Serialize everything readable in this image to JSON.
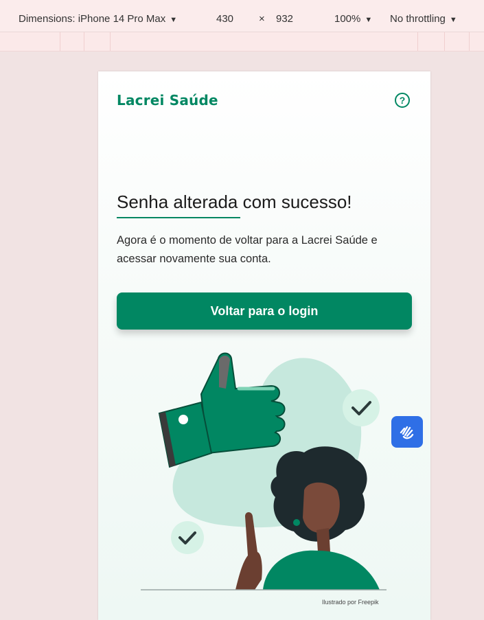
{
  "devtools": {
    "dimensions_label": "Dimensions: iPhone 14 Pro Max",
    "width": "430",
    "times": "×",
    "height": "932",
    "zoom": "100%",
    "throttling": "No throttling",
    "dropdown_glyph": "▼"
  },
  "header": {
    "brand": "Lacrei Saúde",
    "help_glyph": "?"
  },
  "main": {
    "title": "Senha alterada com sucesso!",
    "description": "Agora é o momento de voltar para a Lacrei Saúde e acessar novamente sua conta.",
    "button_label": "Voltar para o login",
    "credit": "Ilustrado por Freepik"
  },
  "icons": {
    "help": "question-circle-icon",
    "accessibility": "sign-language-icon",
    "check": "check-icon"
  },
  "colors": {
    "brand_green": "#018762",
    "accessibility_blue": "#2f6fe6",
    "mint": "#c6e8dd"
  }
}
